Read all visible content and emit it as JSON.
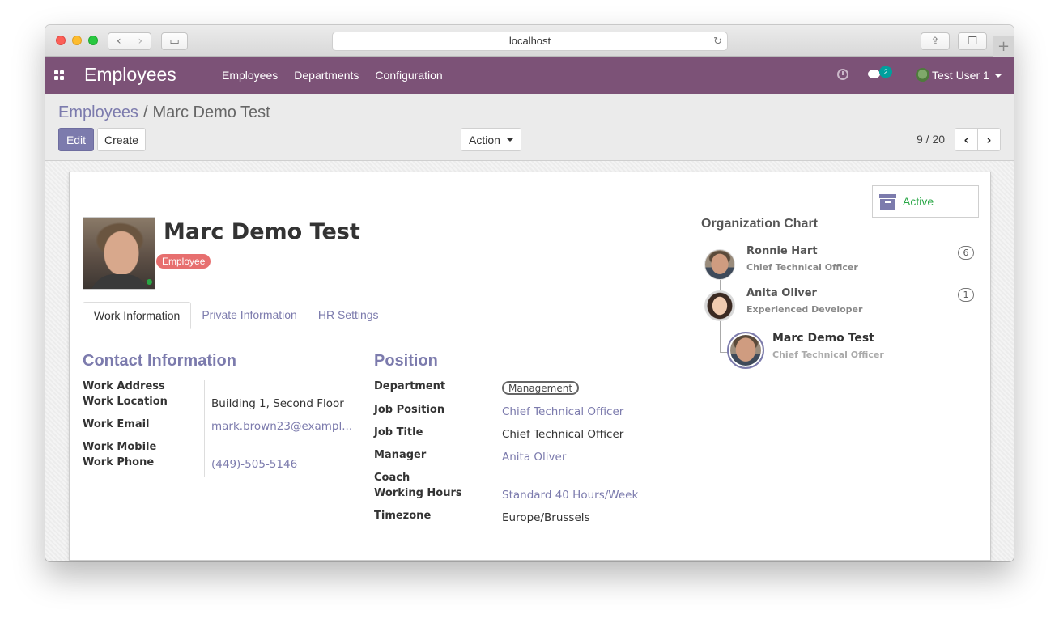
{
  "browser": {
    "url": "localhost"
  },
  "app": {
    "title": "Employees",
    "menu": [
      {
        "label": "Employees"
      },
      {
        "label": "Departments"
      },
      {
        "label": "Configuration"
      }
    ],
    "chat_count": "2",
    "user": "Test User 1",
    "brand_color": "#7c5277",
    "accent_color": "#7c7bad"
  },
  "control_panel": {
    "breadcrumb_parent": "Employees",
    "breadcrumb_separator": "/",
    "breadcrumb_current": "Marc Demo Test",
    "edit_label": "Edit",
    "create_label": "Create",
    "action_label": "Action",
    "pager": "9 / 20"
  },
  "employee": {
    "name": "Marc Demo Test",
    "tag": "Employee",
    "status": "Active",
    "tabs": [
      {
        "label": "Work Information",
        "active": true
      },
      {
        "label": "Private Information",
        "active": false
      },
      {
        "label": "HR Settings",
        "active": false
      }
    ]
  },
  "contact": {
    "title": "Contact Information",
    "labels": {
      "work_address": "Work Address",
      "work_location": "Work Location",
      "work_email": "Work Email",
      "work_mobile": "Work Mobile",
      "work_phone": "Work Phone"
    },
    "values": {
      "work_location": "Building 1, Second Floor",
      "work_email": "mark.brown23@exampl...",
      "work_phone": "(449)-505-5146"
    }
  },
  "position": {
    "title": "Position",
    "labels": {
      "department": "Department",
      "job_position": "Job Position",
      "job_title": "Job Title",
      "manager": "Manager",
      "coach": "Coach",
      "working_hours": "Working Hours",
      "timezone": "Timezone"
    },
    "values": {
      "department": "Management",
      "job_position": "Chief Technical Officer",
      "job_title": "Chief Technical Officer",
      "manager": "Anita Oliver",
      "working_hours": "Standard 40 Hours/Week",
      "timezone": "Europe/Brussels"
    }
  },
  "org_chart": {
    "title": "Organization Chart",
    "people": [
      {
        "name": "Ronnie Hart",
        "job": "Chief Technical Officer",
        "count": "6"
      },
      {
        "name": "Anita Oliver",
        "job": "Experienced Developer",
        "count": "1"
      },
      {
        "name": "Marc Demo Test",
        "job": "Chief Technical Officer"
      }
    ]
  }
}
